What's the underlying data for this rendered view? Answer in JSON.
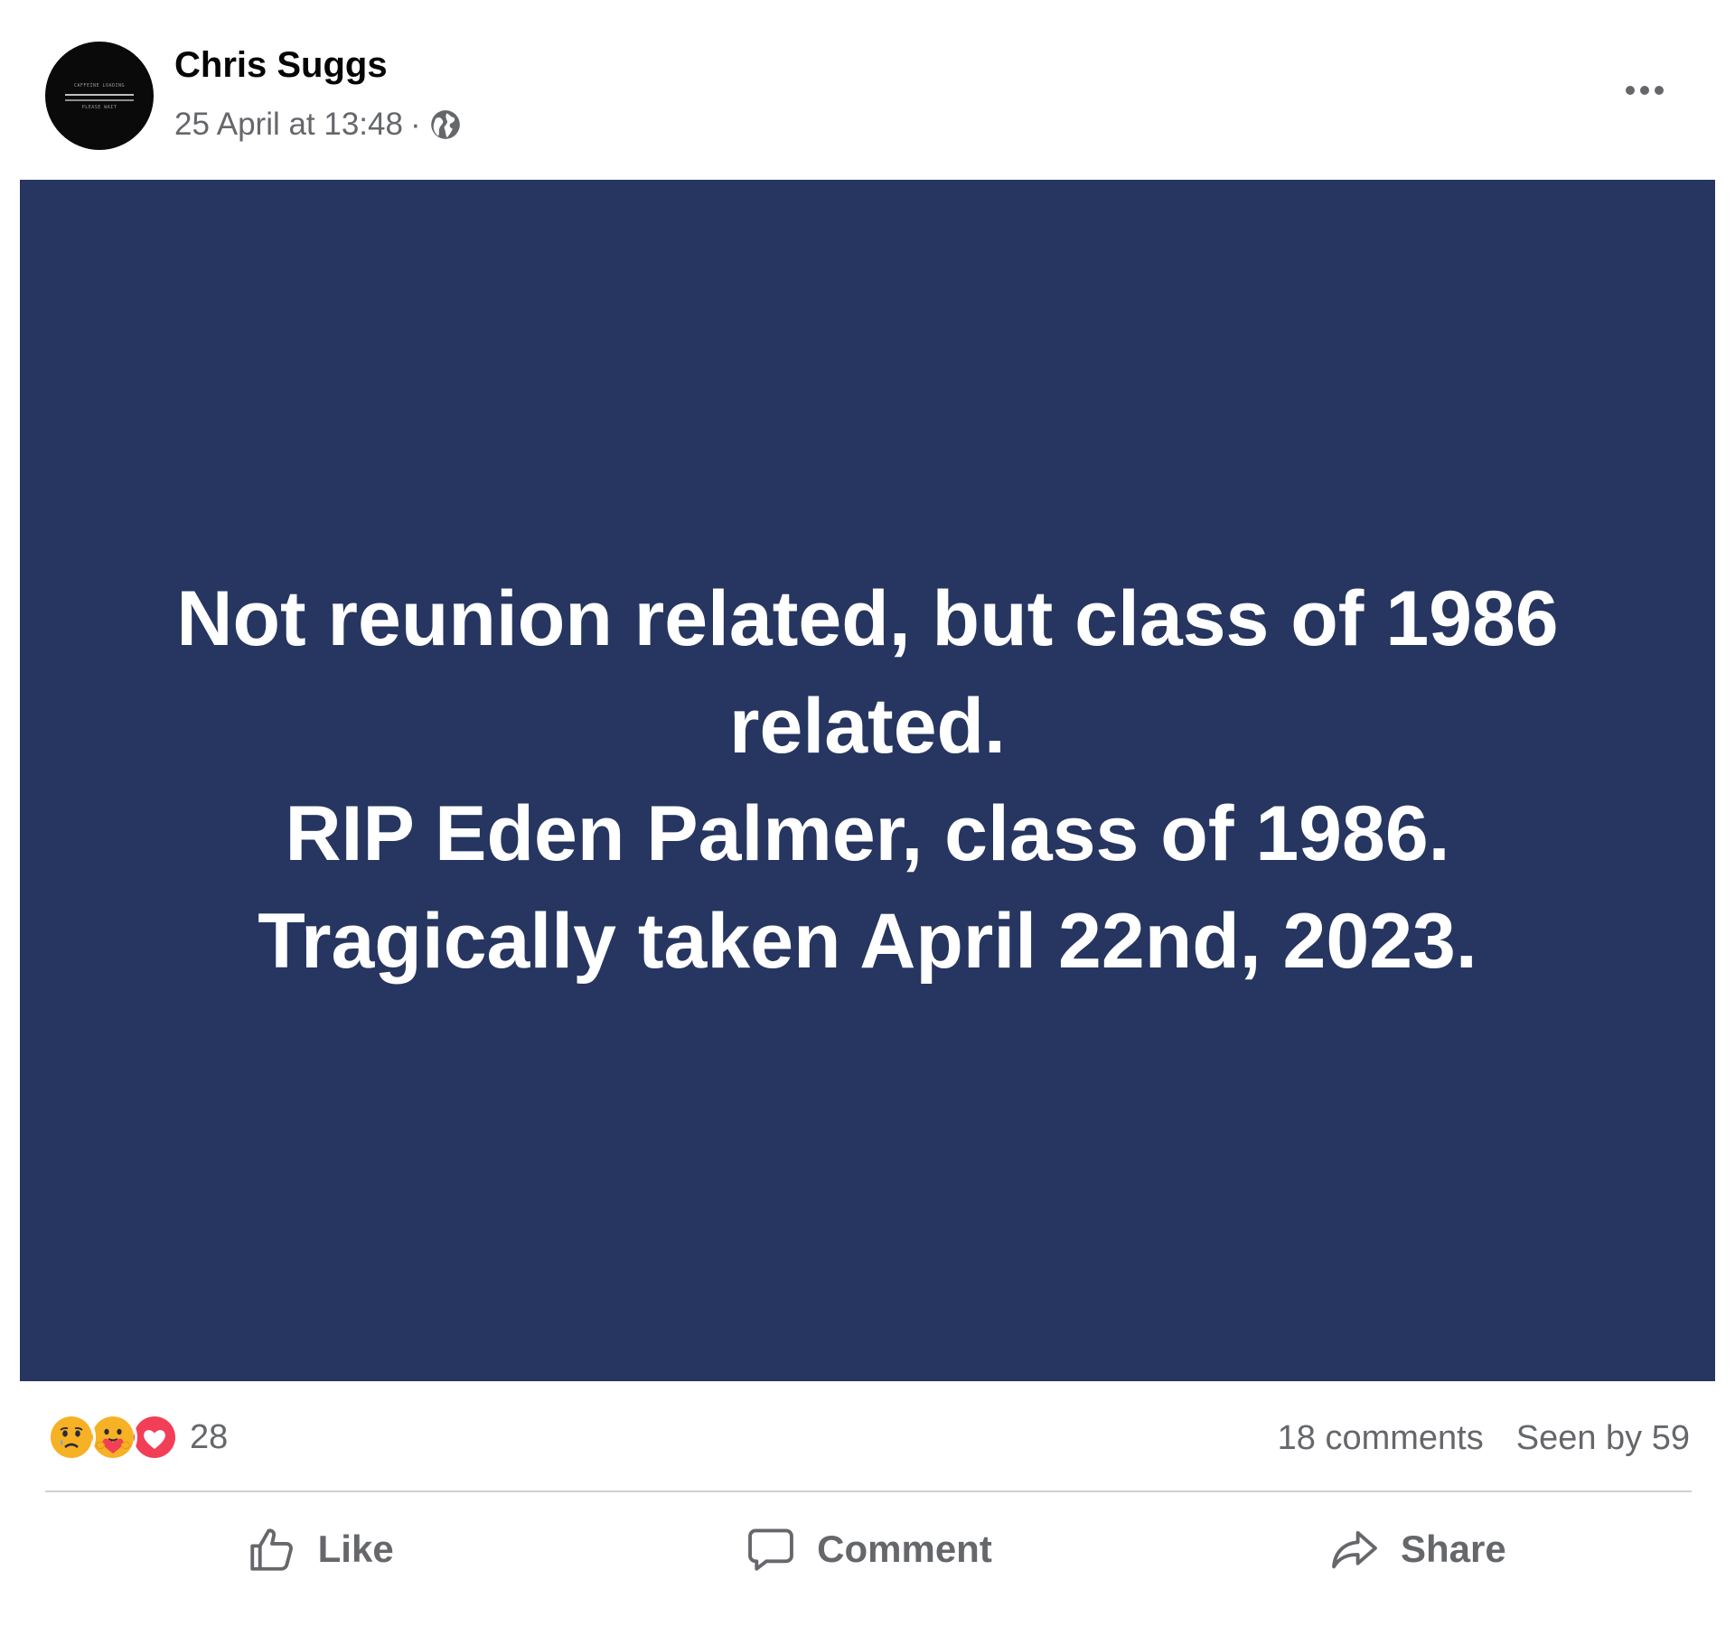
{
  "post": {
    "author": "Chris Suggs",
    "timestamp": "25 April at 13:48",
    "separator": "·",
    "privacy_icon": "globe-icon",
    "avatar_text_line1": "CAFFEINE LOADING",
    "avatar_text_line2": "PLEASE WAIT",
    "card_background": "#263661",
    "card_lines": [
      "Not reunion related, but class of 1986",
      "related.",
      "RIP Eden Palmer, class of 1986.",
      "Tragically taken April 22nd, 2023."
    ]
  },
  "reactions": {
    "icons": [
      "sad-reaction-icon",
      "care-reaction-icon",
      "love-reaction-icon"
    ],
    "count": "28"
  },
  "stats": {
    "comments": "18 comments",
    "seen": "Seen by 59"
  },
  "actions": {
    "like": "Like",
    "comment": "Comment",
    "share": "Share"
  },
  "colors": {
    "card": "#263661",
    "secondary_text": "#65676b",
    "love": "#f33e58"
  }
}
